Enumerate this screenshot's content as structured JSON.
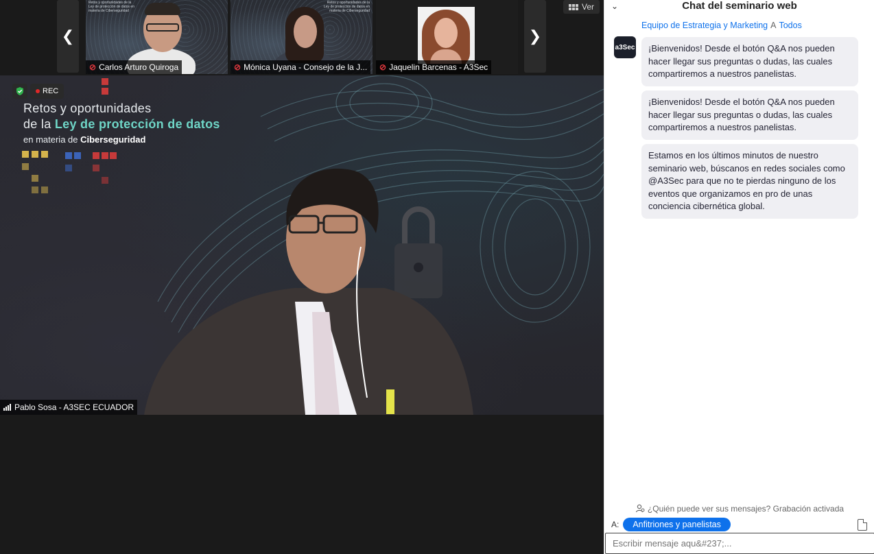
{
  "strip": {
    "view_label": "Ver",
    "thumbnails": [
      {
        "name": "Carlos Arturo Quiroga",
        "slide_text": "Retos y oportunidades de la Ley de protección de datos en materia de Ciberseguridad"
      },
      {
        "name": "Mónica Uyana - Consejo de la J...",
        "slide_text": "Retos y oportunidades de la Ley de protección de datos en materia de Ciberseguridad"
      },
      {
        "name": "Jaquelin Barcenas - A3Sec"
      }
    ]
  },
  "main_video": {
    "rec_label": "REC",
    "slide": {
      "line1": "Retos y oportunidades",
      "line2_prefix": "de la ",
      "line2_bold": "Ley de protección de datos",
      "line3_prefix": "en materia de ",
      "line3_bold": "Ciberseguridad"
    },
    "speaker": "Pablo Sosa - A3SEC ECUADOR"
  },
  "chat": {
    "title": "Chat del seminario web",
    "sender": "Equipo de Estrategia y Marketing",
    "to_word": "A",
    "recipient_all": "Todos",
    "avatar_text": "a3Sec",
    "messages": [
      "¡Bienvenidos! Desde el botón Q&A nos pueden hacer llegar sus preguntas o dudas, las cuales compartiremos a nuestros panelistas.",
      "¡Bienvenidos! Desde el botón Q&A nos pueden hacer llegar sus preguntas o dudas, las cuales compartiremos a nuestros panelistas.",
      "Estamos en los últimos minutos de nuestro seminario web, búscanos en redes sociales como @A3Sec para que no te pierdas ninguno de los eventos que organizamos en pro de unas conciencia cibernética global."
    ],
    "notice": "¿Quién puede ver sus mensajes? Grabación activada",
    "to_label": "A:",
    "recipient": "Anfitriones y panelistas",
    "input_placeholder": "Escribir mensaje aqu&#237;..."
  },
  "colors": {
    "accent": "#0e71eb",
    "slide_highlight": "#6fd6c7",
    "mic_off": "#e0383e",
    "rec_dot": "#e02828"
  }
}
